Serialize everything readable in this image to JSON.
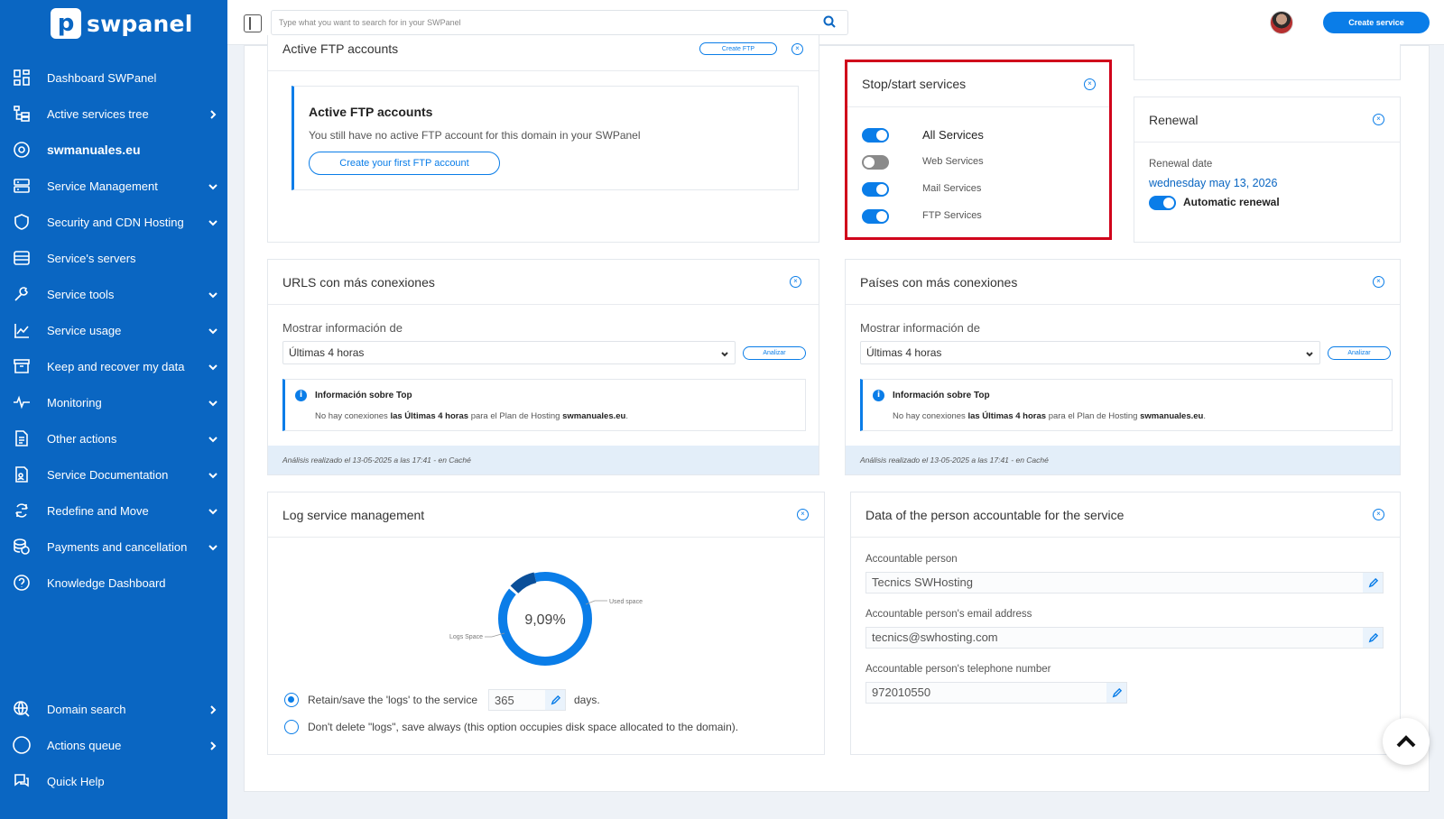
{
  "app": {
    "logo_text": "swpanel",
    "logo_letter": "p"
  },
  "search": {
    "placeholder": "Type what you want to search for in your SWPanel"
  },
  "header": {
    "create_service": "Create service"
  },
  "sidebar": {
    "items": [
      {
        "label": "Dashboard SWPanel",
        "icon": "dashboard-icon"
      },
      {
        "label": "Active services tree",
        "icon": "tree-icon"
      },
      {
        "label": "swmanuales.eu",
        "icon": "globe-icon"
      },
      {
        "label": "Service Management",
        "icon": "server-icon"
      },
      {
        "label": "Security and CDN Hosting",
        "icon": "shield-icon"
      },
      {
        "label": "Service's servers",
        "icon": "servers-icon"
      },
      {
        "label": "Service tools",
        "icon": "tools-icon"
      },
      {
        "label": "Service usage",
        "icon": "chart-icon"
      },
      {
        "label": "Keep and recover my data",
        "icon": "archive-icon"
      },
      {
        "label": "Monitoring",
        "icon": "pulse-icon"
      },
      {
        "label": "Other actions",
        "icon": "document-icon"
      },
      {
        "label": "Service Documentation",
        "icon": "doc-user-icon"
      },
      {
        "label": "Redefine and Move",
        "icon": "refresh-icon"
      },
      {
        "label": "Payments and cancellation",
        "icon": "coins-icon"
      },
      {
        "label": "Knowledge Dashboard",
        "icon": "help-icon"
      }
    ],
    "bottom_items": [
      {
        "label": "Domain search",
        "icon": "domain-icon"
      },
      {
        "label": "Actions queue",
        "icon": "circle-icon"
      },
      {
        "label": "Quick Help",
        "icon": "chat-icon"
      }
    ]
  },
  "ftp": {
    "header_title": "Active FTP accounts",
    "create_btn": "Create FTP",
    "box_title": "Active FTP accounts",
    "box_text": "You still have no active FTP account for this domain in your SWPanel",
    "create_first": "Create your first FTP account"
  },
  "stopstart": {
    "title": "Stop/start services",
    "services": [
      {
        "label": "All Services",
        "on": true
      },
      {
        "label": "Web Services",
        "on": false
      },
      {
        "label": "Mail Services",
        "on": true
      },
      {
        "label": "FTP Services",
        "on": true
      }
    ]
  },
  "renewal": {
    "title": "Renewal",
    "date_label": "Renewal date",
    "date_value": "wednesday may 13, 2026",
    "auto_label": "Automatic renewal"
  },
  "urls": {
    "title": "URLS con más conexiones",
    "show_label": "Mostrar información de",
    "select_value": "Últimas 4 horas",
    "analyze": "Analizar",
    "info_title": "Información sobre Top",
    "info_text_1": "No hay conexiones ",
    "info_text_2": "las Últimas 4 horas",
    "info_text_3": " para el Plan de Hosting ",
    "info_text_4": "swmanuales.eu",
    "info_text_5": ".",
    "footnote": "Análisis realizado el 13-05-2025 a las 17:41 - en Caché"
  },
  "paises": {
    "title": "Países con más conexiones",
    "show_label": "Mostrar información de",
    "select_value": "Últimas 4 horas",
    "analyze": "Analizar",
    "info_title": "Información sobre Top",
    "info_text_1": "No hay conexiones ",
    "info_text_2": "las Últimas 4 horas",
    "info_text_3": " para el Plan de Hosting ",
    "info_text_4": "swmanuales.eu",
    "info_text_5": ".",
    "footnote": "Análisis realizado el 13-05-2025 a las 17:41 - en Caché"
  },
  "logs": {
    "title": "Log service management",
    "donut_value": "9,09%",
    "donut_fraction": 0.0909,
    "used_label": "Used space",
    "logs_label": "Logs Space",
    "retain_label": "Retain/save the 'logs' to the service",
    "retain_days": "365",
    "days_label": "days.",
    "never_label": "Don't delete \"logs\", save always (this option occupies disk space allocated to the domain).",
    "colors": {
      "used": "#0a7de8",
      "logs": "#0a4f99"
    }
  },
  "accountable": {
    "title": "Data of the person accountable for the service",
    "person_label": "Accountable person",
    "person_value": "Tecnics SWHosting",
    "email_label": "Accountable person's email address",
    "email_value": "tecnics@swhosting.com",
    "phone_label": "Accountable person's telephone number",
    "phone_value": "972010550"
  },
  "colors": {
    "sidebar": "#0a66c2",
    "accent": "#0a7de8",
    "highlight": "#d0021b"
  }
}
